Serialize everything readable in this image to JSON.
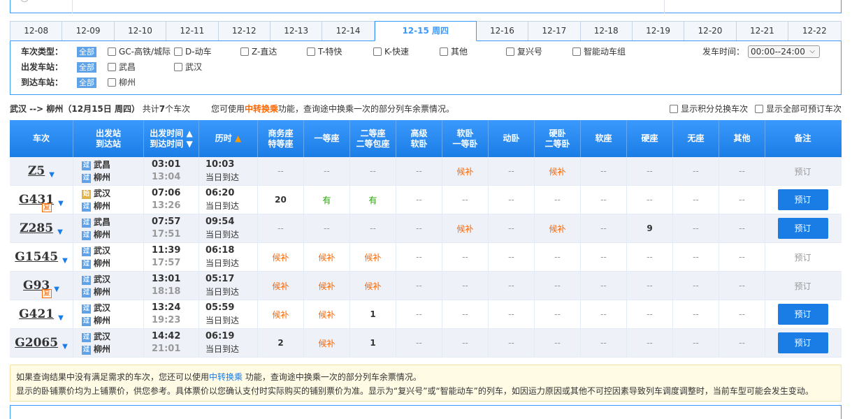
{
  "date_tabs": [
    "12-08",
    "12-09",
    "12-10",
    "12-11",
    "12-12",
    "12-13",
    "12-14",
    "12-15 周四",
    "12-16",
    "12-17",
    "12-18",
    "12-19",
    "12-20",
    "12-21",
    "12-22"
  ],
  "active_tab": 7,
  "filters": {
    "train_type_label": "车次类型：",
    "all": "全部",
    "types": [
      "GC-高铁/城际",
      "D-动车",
      "Z-直达",
      "T-特快",
      "K-快速",
      "其他",
      "复兴号",
      "智能动车组"
    ],
    "from_label": "出发车站：",
    "from_stations": [
      "武昌",
      "武汉"
    ],
    "to_label": "到达车站：",
    "to_stations": [
      "柳州"
    ],
    "time_label": "发车时间：",
    "time_value": "00:00--24:00"
  },
  "summary": {
    "route": "武汉 --> 柳州（12月15日 周四）",
    "count_prefix": "共计",
    "count": "7",
    "count_suffix": "个车次",
    "tip_prefix": "您可使用",
    "tip_link": "中转换乘",
    "tip_suffix": "功能，查询途中换乘一次的部分列车余票情况。",
    "opt1": "显示积分兑换车次",
    "opt2": "显示全部可预订车次"
  },
  "headers": {
    "train": "车次",
    "station1": "出发站",
    "station2": "到达站",
    "time1": "出发时间",
    "time2": "到达时间",
    "duration": "历时",
    "biz1": "商务座",
    "biz2": "特等座",
    "first": "一等座",
    "second1": "二等座",
    "second2": "二等包座",
    "adv1": "高级",
    "adv2": "软卧",
    "soft1": "软卧",
    "soft2": "一等卧",
    "move": "动卧",
    "hard1": "硬卧",
    "hard2": "二等卧",
    "softseat": "软座",
    "hardseat": "硬座",
    "noseat": "无座",
    "other": "其他",
    "remark": "备注"
  },
  "trains": [
    {
      "no": "Z5",
      "fu": "",
      "s1b": "过",
      "s1": "武昌",
      "s2b": "过",
      "s2": "柳州",
      "dep": "03:01",
      "arr": "13:04",
      "dur": "10:03",
      "day": "当日到达",
      "seats": [
        "--",
        "--",
        "--",
        "--",
        "候补",
        "--",
        "候补",
        "--",
        "--",
        "--",
        "--"
      ],
      "book": "预订",
      "bookable": false
    },
    {
      "no": "G431",
      "fu": "复",
      "s1b": "始",
      "s1": "武汉",
      "s2b": "过",
      "s2": "柳州",
      "dep": "07:06",
      "arr": "13:26",
      "dur": "06:20",
      "day": "当日到达",
      "seats": [
        "20",
        "有",
        "有",
        "--",
        "--",
        "--",
        "--",
        "--",
        "--",
        "--",
        "--"
      ],
      "book": "预订",
      "bookable": true
    },
    {
      "no": "Z285",
      "fu": "",
      "s1b": "过",
      "s1": "武昌",
      "s2b": "过",
      "s2": "柳州",
      "dep": "07:57",
      "arr": "17:51",
      "dur": "09:54",
      "day": "当日到达",
      "seats": [
        "--",
        "--",
        "--",
        "--",
        "候补",
        "--",
        "候补",
        "--",
        "9",
        "--",
        "--"
      ],
      "book": "预订",
      "bookable": true
    },
    {
      "no": "G1545",
      "fu": "",
      "s1b": "过",
      "s1": "武汉",
      "s2b": "过",
      "s2": "柳州",
      "dep": "11:39",
      "arr": "17:57",
      "dur": "06:18",
      "day": "当日到达",
      "seats": [
        "候补",
        "候补",
        "候补",
        "--",
        "--",
        "--",
        "--",
        "--",
        "--",
        "--",
        "--"
      ],
      "book": "预订",
      "bookable": false
    },
    {
      "no": "G93",
      "fu": "复",
      "s1b": "过",
      "s1": "武汉",
      "s2b": "过",
      "s2": "柳州",
      "dep": "13:01",
      "arr": "18:18",
      "dur": "05:17",
      "day": "当日到达",
      "seats": [
        "候补",
        "候补",
        "候补",
        "--",
        "--",
        "--",
        "--",
        "--",
        "--",
        "--",
        "--"
      ],
      "book": "预订",
      "bookable": false
    },
    {
      "no": "G421",
      "fu": "",
      "s1b": "过",
      "s1": "武汉",
      "s2b": "过",
      "s2": "柳州",
      "dep": "13:24",
      "arr": "19:23",
      "dur": "05:59",
      "day": "当日到达",
      "seats": [
        "候补",
        "候补",
        "1",
        "--",
        "--",
        "--",
        "--",
        "--",
        "--",
        "--",
        "--"
      ],
      "book": "预订",
      "bookable": true
    },
    {
      "no": "G2065",
      "fu": "",
      "s1b": "过",
      "s1": "武汉",
      "s2b": "过",
      "s2": "柳州",
      "dep": "14:42",
      "arr": "21:01",
      "dur": "06:19",
      "day": "当日到达",
      "seats": [
        "2",
        "候补",
        "1",
        "--",
        "--",
        "--",
        "--",
        "--",
        "--",
        "--",
        "--"
      ],
      "book": "预订",
      "bookable": true
    }
  ],
  "note": {
    "line1_a": "如果查询结果中没有满足需求的车次，您还可以使用",
    "line1_link": "中转换乘",
    "line1_b": " 功能，查询途中换乘一次的部分列车余票情况。",
    "line2": "显示的卧铺票价均为上铺票价，供您参考。具体票价以您确认支付时实际购买的铺别票价为准。显示为“复兴号”或“智能动车”的列车，如因运力原因或其他不可控因素导致列车调度调整时，当前车型可能会发生变动。"
  },
  "colors": {
    "accent": "#3b99fc",
    "book": "#1a7de6",
    "wait": "#ff6600",
    "you": "#26a306"
  }
}
